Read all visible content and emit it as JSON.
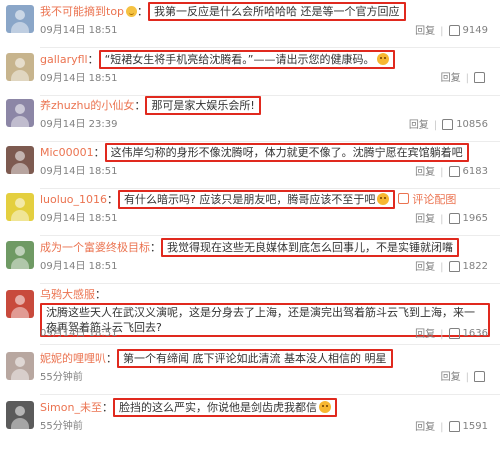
{
  "actions": {
    "reply": "回复"
  },
  "comments": [
    {
      "user": "我不可能摘到top",
      "colon": "：",
      "text": "我第一反应是什么会所哈哈哈 还是等一个官方回应",
      "time": "09月14日 18:51",
      "likes": "9149",
      "avatar_color": "#8aa6c8"
    },
    {
      "user": "gallaryfll",
      "colon": "：",
      "text": "“短裙女生将手机亮给沈腾看。”——请出示您的健康码。",
      "time": "09月14日 18:51",
      "likes": "",
      "avatar_color": "#c7b48d"
    },
    {
      "user": "养zhuzhu的小仙女",
      "colon": "：",
      "text": "那可是家大娱乐会所!",
      "time": "09月14日 23:39",
      "likes": "10856",
      "avatar_color": "#8c86a6"
    },
    {
      "user": "Mic00001",
      "colon": "：",
      "text": "这伟岸匀称的身形不像沈腾呀，体力就更不像了。沈腾宁愿在宾馆躺着吧",
      "time": "09月14日 18:51",
      "likes": "6183",
      "avatar_color": "#7d5a50"
    },
    {
      "user": "luoluo_1016",
      "colon": "：",
      "text": "有什么暗示吗? 应该只是朋友吧，腾哥应该不至于吧",
      "link": "评论配图",
      "time": "09月14日 18:51",
      "likes": "1965",
      "avatar_color": "#e4cf3f"
    },
    {
      "user": "成为一个富婆终极目标",
      "colon": "：",
      "text": "我觉得现在这些无良媒体到底怎么回事儿，不是实锤就闭嘴",
      "time": "09月14日 18:51",
      "likes": "1822",
      "avatar_color": "#6f9a64"
    },
    {
      "user": "乌鸦大感服",
      "colon": "：",
      "text": "沈腾这些天人在武汉义演呢，这是分身去了上海，还是演完出驾着筋斗云飞到上海，来一夜再驾着筋斗云飞回去?",
      "time": "09月14日 18:51",
      "likes": "1636",
      "avatar_color": "#c84a3c"
    },
    {
      "user": "妮妮的哩哩叭",
      "colon": "：",
      "text": "第一个有缔闻 底下评论如此清流 基本没人相信的 明星",
      "time": "55分钟前",
      "likes": "",
      "avatar_color": "#b8a7a0"
    },
    {
      "user": "Simon_未至",
      "colon": "：",
      "text": "脸挡的这么严实，你说他是剑齿虎我都信",
      "time": "55分钟前",
      "likes": "1591",
      "avatar_color": "#5b5b5b"
    }
  ]
}
